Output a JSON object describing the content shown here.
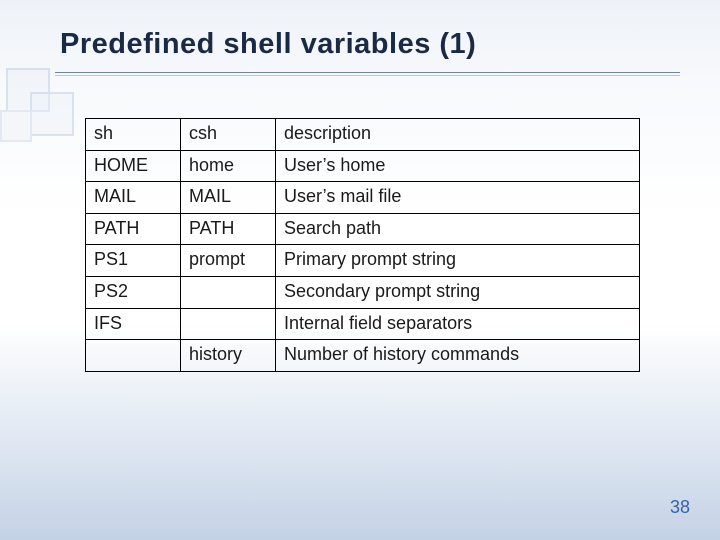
{
  "title": "Predefined shell variables (1)",
  "page_number": "38",
  "table": {
    "headers": {
      "sh": "sh",
      "csh": "csh",
      "desc": "description"
    },
    "rows": [
      {
        "sh": "HOME",
        "csh": "home",
        "desc": "User’s home"
      },
      {
        "sh": "MAIL",
        "csh": "MAIL",
        "desc": "User’s mail file"
      },
      {
        "sh": "PATH",
        "csh": "PATH",
        "desc": "Search path"
      },
      {
        "sh": "PS1",
        "csh": "prompt",
        "desc": "Primary prompt string"
      },
      {
        "sh": "PS2",
        "csh": "",
        "desc": "Secondary prompt string"
      },
      {
        "sh": "IFS",
        "csh": "",
        "desc": "Internal field separators"
      },
      {
        "sh": "",
        "csh": "history",
        "desc": "Number of history commands"
      }
    ]
  }
}
